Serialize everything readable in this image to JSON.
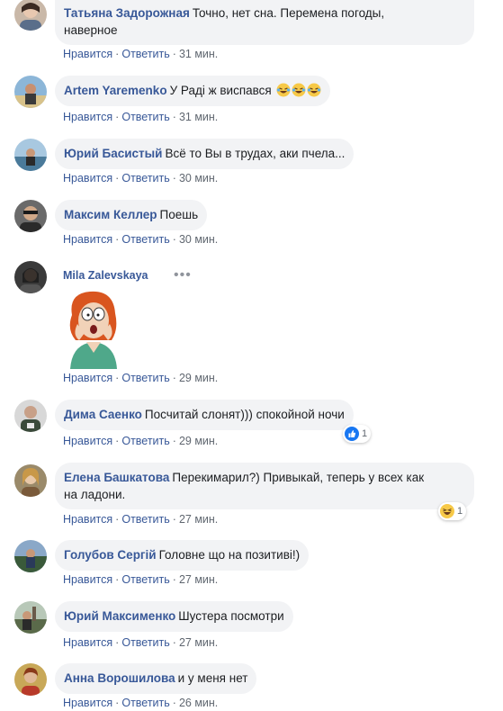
{
  "actions": {
    "like": "Нравится",
    "reply": "Ответить",
    "separator": "·"
  },
  "colors": {
    "author": "#385898",
    "bubble": "#f2f3f5",
    "meta": "#606770",
    "like_blue": "#1877f2"
  },
  "comments": [
    {
      "author": "Татьяна Задорожная",
      "text": "Точно, нет сна. Перемена погоды,",
      "text2": "наверное",
      "time": "31 мин.",
      "avatar": "avatar-photo"
    },
    {
      "author": "Artem Yaremenko",
      "text": "У Раді ж виспався",
      "emojis": [
        "rofl-emoji",
        "rofl-emoji",
        "rofl-emoji"
      ],
      "time": "31 мин.",
      "avatar": "avatar-photo"
    },
    {
      "author": "Юрий Басистый",
      "text": "Всё то Вы в трудах, аки пчела...",
      "time": "30 мин.",
      "avatar": "avatar-photo"
    },
    {
      "author": "Максим Келлер",
      "text": "Поешь",
      "time": "30 мин.",
      "avatar": "avatar-photo"
    },
    {
      "author": "Mila Zalevskaya",
      "more": "•••",
      "sticker": "cartoon-woman-sticker",
      "time": "29 мин.",
      "avatar": "avatar-photo"
    },
    {
      "author": "Дима Саенко",
      "text": "Посчитай слонят))) спокойной ночи",
      "time": "29 мин.",
      "avatar": "avatar-photo",
      "reaction": {
        "icon": "like-icon",
        "count": "1"
      }
    },
    {
      "author": "Елена Башкатова",
      "text": "Перекимарил?) Привыкай, теперь у всех как",
      "text2": "на ладони.",
      "time": "27 мин.",
      "avatar": "avatar-photo",
      "reaction": {
        "icon": "haha-icon",
        "count": "1"
      }
    },
    {
      "author": "Голубов Сергій",
      "text": "Головне що на позитиві!)",
      "time": "27 мин.",
      "avatar": "avatar-photo"
    },
    {
      "author": "Юрий Максименко",
      "text": "Шустера посмотри",
      "time": "27 мин.",
      "avatar": "avatar-photo"
    },
    {
      "author": "Анна Ворошилова",
      "text": "и у меня нет",
      "time": "26 мин.",
      "avatar": "avatar-photo"
    }
  ]
}
